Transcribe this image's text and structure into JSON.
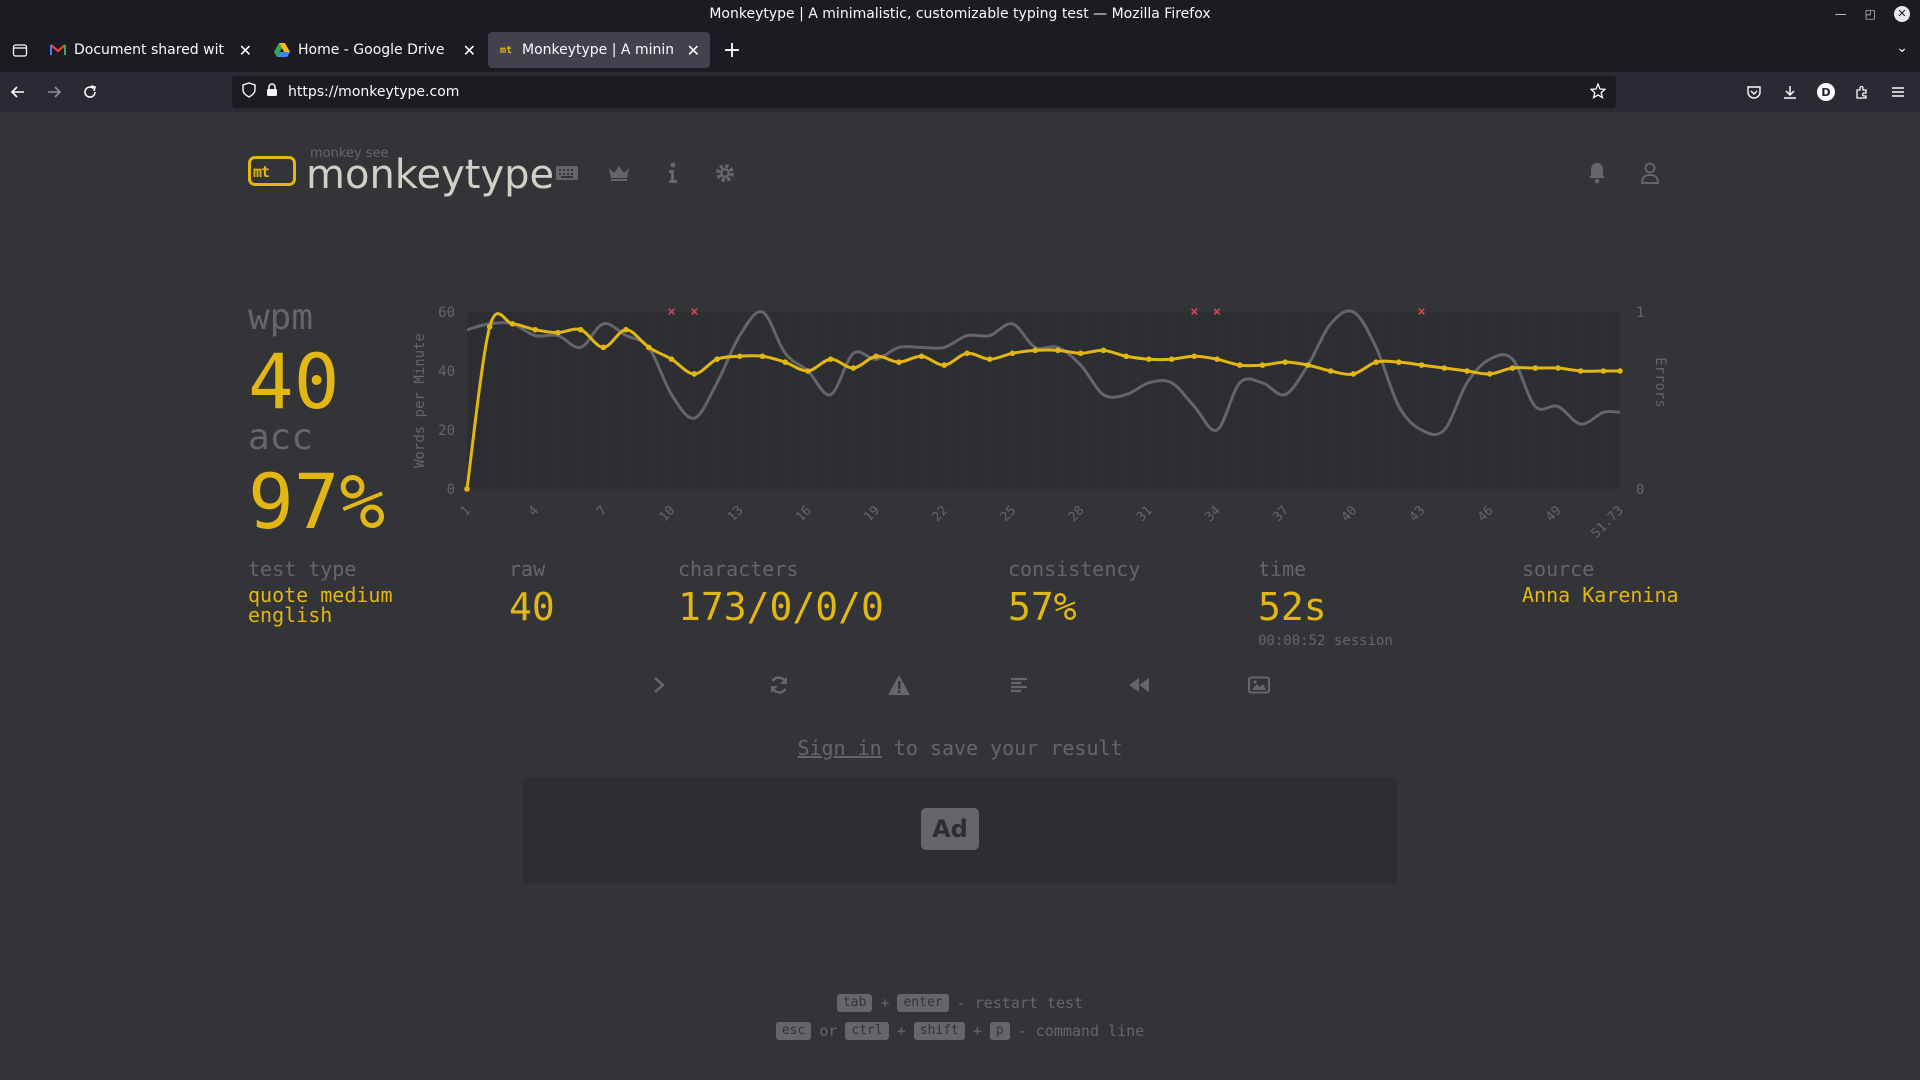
{
  "browser": {
    "window_title": "Monkeytype | A minimalistic, customizable typing test — Mozilla Firefox",
    "tabs": [
      {
        "title": "Document shared with you",
        "icon": "gmail-icon",
        "active": false
      },
      {
        "title": "Home - Google Drive",
        "icon": "google-drive-icon",
        "active": false
      },
      {
        "title": "Monkeytype | A minimalist",
        "icon": "monkeytype-icon",
        "active": true
      }
    ],
    "url": "https://monkeytype.com",
    "profile_initial": "D"
  },
  "header": {
    "logo_text": "mt",
    "subtitle": "monkey see",
    "title": "monkeytype"
  },
  "result": {
    "wpm_label": "wpm",
    "wpm": "40",
    "acc_label": "acc",
    "acc": "97%"
  },
  "stats": {
    "test_type_label": "test type",
    "test_type_line1": "quote medium",
    "test_type_line2": "english",
    "raw_label": "raw",
    "raw": "40",
    "characters_label": "characters",
    "characters": "173/0/0/0",
    "consistency_label": "consistency",
    "consistency": "57%",
    "time_label": "time",
    "time": "52s",
    "time_session": "00:00:52 session",
    "source_label": "source",
    "source": "Anna Karenina"
  },
  "chart_data": {
    "type": "line",
    "ylabel": "Words per Minute",
    "y2label": "Errors",
    "ylim": [
      0,
      60
    ],
    "y2lim": [
      0,
      1
    ],
    "y_ticks": [
      "0",
      "20",
      "40",
      "60"
    ],
    "y2_ticks": [
      "0",
      "1"
    ],
    "x_ticks": [
      "1",
      "4",
      "7",
      "10",
      "13",
      "16",
      "19",
      "22",
      "25",
      "28",
      "31",
      "34",
      "37",
      "40",
      "43",
      "46",
      "49",
      "51.73"
    ],
    "x": [
      1,
      2,
      3,
      4,
      5,
      6,
      7,
      8,
      9,
      10,
      11,
      12,
      13,
      14,
      15,
      16,
      17,
      18,
      19,
      20,
      21,
      22,
      23,
      24,
      25,
      26,
      27,
      28,
      29,
      30,
      31,
      32,
      33,
      34,
      35,
      36,
      37,
      38,
      39,
      40,
      41,
      42,
      43,
      44,
      45,
      46,
      47,
      48,
      49,
      50,
      51,
      51.73
    ],
    "series": [
      {
        "name": "wpm",
        "color": "#e2b714",
        "values": [
          0,
          55,
          56,
          54,
          53,
          54,
          48,
          54,
          48,
          44,
          39,
          44,
          45,
          45,
          43,
          40,
          44,
          41,
          45,
          43,
          45,
          42,
          46,
          44,
          46,
          47,
          47,
          46,
          47,
          45,
          44,
          44,
          45,
          44,
          42,
          42,
          43,
          42,
          40,
          39,
          43,
          43,
          42,
          41,
          40,
          39,
          41,
          41,
          41,
          40,
          40,
          40
        ]
      },
      {
        "name": "raw",
        "color": "#646669",
        "values": [
          54,
          56,
          56,
          52,
          52,
          48,
          56,
          52,
          48,
          32,
          24,
          36,
          52,
          60,
          46,
          40,
          32,
          46,
          44,
          48,
          48,
          48,
          52,
          52,
          56,
          48,
          48,
          42,
          32,
          32,
          36,
          36,
          28,
          20,
          36,
          36,
          32,
          42,
          56,
          60,
          48,
          28,
          20,
          20,
          36,
          44,
          44,
          28,
          28,
          22,
          26,
          26
        ]
      }
    ],
    "errors_at_x": [
      10,
      11,
      33,
      34,
      43
    ]
  },
  "actions": {
    "next_test": "next-test-icon",
    "restart": "restart-icon",
    "report": "warning-icon",
    "words_history": "align-left-icon",
    "replay": "backward-icon",
    "screenshot": "image-icon"
  },
  "signin": {
    "link": "Sign in",
    "rest": "to save your result"
  },
  "ad": {
    "label": "Ad"
  },
  "hints": {
    "row1": {
      "k1": "tab",
      "plus": "+",
      "k2": "enter",
      "text": "- restart test"
    },
    "row2": {
      "k1": "esc",
      "or": "or",
      "k2": "ctrl",
      "plus1": "+",
      "k3": "shift",
      "plus2": "+",
      "k4": "p",
      "text": "- command line"
    }
  },
  "colors": {
    "background": "#323437",
    "accent": "#e2b714",
    "muted": "#646669",
    "text": "#d1d0c5",
    "error": "#ca4754"
  }
}
